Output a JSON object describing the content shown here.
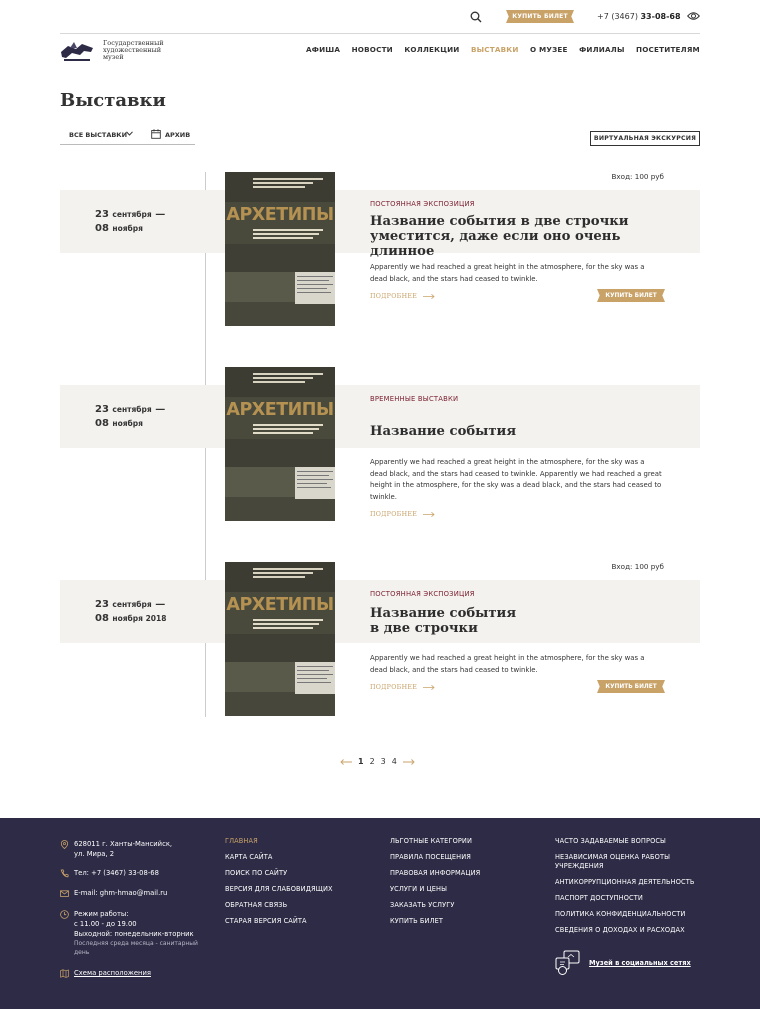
{
  "topbar": {
    "buy_label": "КУПИТЬ БИЛЕТ",
    "phone_prefix": "+7 (3467)",
    "phone_number": "33-08-68"
  },
  "header": {
    "logo_text": [
      "Государственный",
      "художественный",
      "музей"
    ],
    "nav": [
      {
        "label": "АФИША",
        "active": false
      },
      {
        "label": "НОВОСТИ",
        "active": false
      },
      {
        "label": "КОЛЛЕКЦИИ",
        "active": false
      },
      {
        "label": "ВЫСТАВКИ",
        "active": true
      },
      {
        "label": "О МУЗЕЕ",
        "active": false
      },
      {
        "label": "ФИЛИАЛЫ",
        "active": false
      },
      {
        "label": "ПОСЕТИТЕЛЯМ",
        "active": false
      }
    ]
  },
  "page": {
    "title": "Выставки",
    "filter_all": "ВСЕ ВЫСТАВКИ",
    "filter_archive": "АРХИВ",
    "virtual_tour": "ВИРТУАЛЬНАЯ ЭКСКУРСИЯ"
  },
  "poster": {
    "title": "АРХЕТИПЫ"
  },
  "events": [
    {
      "price": "Вход: 100 руб",
      "date_from_day": "23",
      "date_from_month": "сентября",
      "date_to_day": "08",
      "date_to_month": "ноября",
      "tag": "ПОСТОЯННАЯ ЭКСПОЗИЦИЯ",
      "title_lines": [
        "Название события в две строчки",
        "уместится, даже если оно очень длинное"
      ],
      "desc_lines": [
        "Apparently we had reached a great height in the atmosphere, for the sky was a",
        "dead black, and the stars had ceased to twinkle."
      ],
      "more": "ПОДРОБНЕЕ",
      "buy": "КУПИТЬ БИЛЕТ"
    },
    {
      "price": "",
      "date_from_day": "23",
      "date_from_month": "сентября",
      "date_to_day": "08",
      "date_to_month": "ноября",
      "tag": "ВРЕМЕННЫЕ ВЫСТАВКИ",
      "title_lines": [
        "Название события"
      ],
      "desc_lines": [
        "Apparently we had reached a great height in the atmosphere, for the sky was a",
        "dead black, and the stars had ceased to twinkle. Apparently we had reached a great",
        "height in the atmosphere, for the sky was a dead black, and the stars had ceased to",
        "twinkle."
      ],
      "more": "ПОДРОБНЕЕ",
      "buy": ""
    },
    {
      "price": "Вход: 100 руб",
      "date_from_day": "23",
      "date_from_month": "сентября",
      "date_to_day": "08",
      "date_to_month": "ноября 2018",
      "tag": "ПОСТОЯННАЯ ЭКСПОЗИЦИЯ",
      "title_lines": [
        "Название события",
        "в две строчки"
      ],
      "desc_lines": [
        "Apparently we had reached a great height in the atmosphere, for the sky was a",
        "dead black, and the stars had ceased to twinkle."
      ],
      "more": "ПОДРОБНЕЕ",
      "buy": "КУПИТЬ БИЛЕТ"
    }
  ],
  "pager": {
    "pages": [
      "1",
      "2",
      "3",
      "4"
    ],
    "current": "1"
  },
  "footer": {
    "address": [
      "628011 г. Ханты-Мансийск,",
      "ул. Мира, 2"
    ],
    "phone": "Тел: +7 (3467) 33-08-68",
    "email": "E-mail: ghm-hmao@mail.ru",
    "hours": [
      "Режим работы:",
      "с 11.00 - до 19.00",
      "Выходной: понедельник-вторник"
    ],
    "hours_note": [
      "Последняя среда месяца - санитарный",
      "день"
    ],
    "scheme": "Схема расположения",
    "col1": [
      "ГЛАВНАЯ",
      "КАРТА САЙТА",
      "ПОИСК ПО САЙТУ",
      "ВЕРСИЯ ДЛЯ СЛАБОВИДЯЩИХ",
      "ОБРАТНАЯ СВЯЗЬ",
      "СТАРАЯ ВЕРСИЯ САЙТА"
    ],
    "col2": [
      "ЛЬГОТНЫЕ КАТЕГОРИИ",
      "ПРАВИЛА ПОСЕЩЕНИЯ",
      "ПРАВОВАЯ ИНФОРМАЦИЯ",
      "УСЛУГИ И ЦЕНЫ",
      "ЗАКАЗАТЬ УСЛУГУ",
      "КУПИТЬ БИЛЕТ"
    ],
    "col3": [
      "ЧАСТО ЗАДАВАЕМЫЕ ВОПРОСЫ",
      "НЕЗАВИСИМАЯ ОЦЕНКА РАБОТЫ\nУЧРЕЖДЕНИЯ",
      "АНТИКОРРУПЦИОННАЯ ДЕЯТЕЛЬНОСТЬ",
      "ПАСПОРТ ДОСТУПНОСТИ",
      "ПОЛИТИКА КОНФИДЕНЦИАЛЬНОСТИ",
      "СВЕДЕНИЯ О ДОХОДАХ И РАСХОДАХ"
    ],
    "social": "Музей в социальных сетях"
  },
  "colors": {
    "accent": "#c9a268",
    "footer_bg": "#2d2b45",
    "tag": "#7a1f2e",
    "band": "#f4f2ef"
  }
}
